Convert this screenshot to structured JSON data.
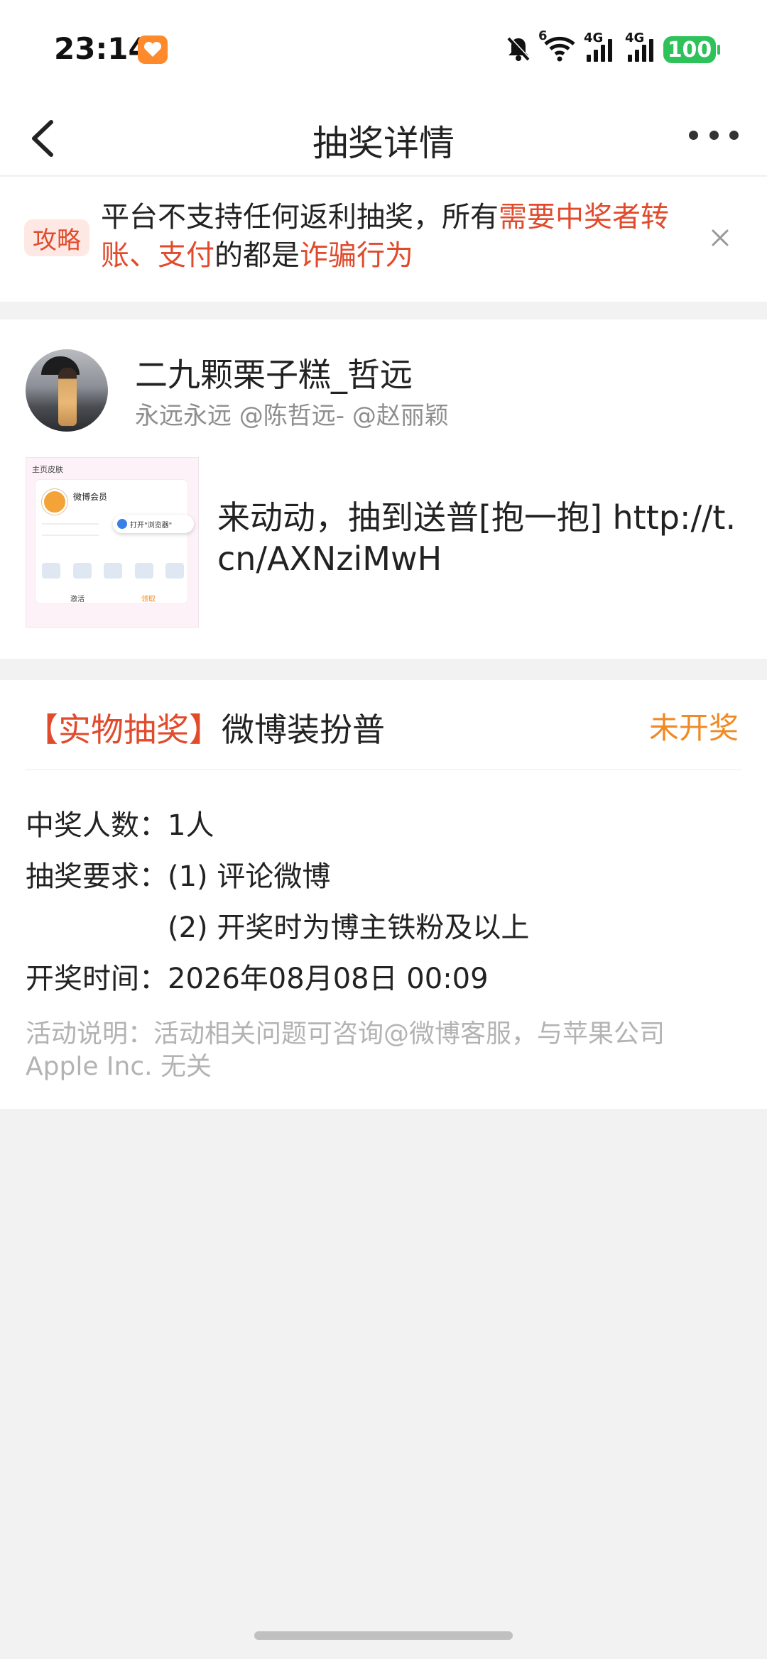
{
  "status_bar": {
    "time": "23:14",
    "battery": "100",
    "network_1": "4G",
    "network_2": "4G",
    "wifi_badge": "6",
    "icons": [
      "app-heart-icon",
      "mute-bell-icon",
      "wifi-icon",
      "signal-icon",
      "signal-icon",
      "battery-icon"
    ]
  },
  "navbar": {
    "title": "抽奖详情",
    "back_icon": "chevron-left-icon",
    "more_icon": "more-dots-icon"
  },
  "notice": {
    "tag": "攻略",
    "text_1": "平台不支持任何返利抽奖，所有",
    "text_red_1": "需要中奖者转账、支付",
    "text_2": "的都是",
    "text_red_2": "诈骗行为",
    "close_icon": "close-icon",
    "accent_color": "#e24a2c"
  },
  "post": {
    "author": "二九颗栗子糕_哲远",
    "subtitle": "永远永远 @陈哲远- @赵丽颖",
    "text": "来动动，抽到送普[抱一抱] http://t.cn/AXNziMwH",
    "thumbnail": {
      "header": "主页皮肤",
      "vip_label": "微博会员",
      "popup": "打开\"浏览器\"",
      "left_button": "激活",
      "right_button": "领取"
    }
  },
  "lottery": {
    "prize_type": "【实物抽奖】",
    "prize_name": "微博装扮普",
    "status": "未开奖",
    "winners_label": "中奖人数：",
    "winners_value": "1人",
    "requirements_label": "抽奖要求：",
    "requirement_1": "(1) 评论微博",
    "requirement_2": "(2) 开奖时为博主铁粉及以上",
    "draw_time_label": "开奖时间：",
    "draw_time_value": "2026年08月08日 00:09",
    "footnote": "活动说明：活动相关问题可咨询@微博客服，与苹果公司 Apple Inc. 无关",
    "status_color": "#f08a24"
  }
}
